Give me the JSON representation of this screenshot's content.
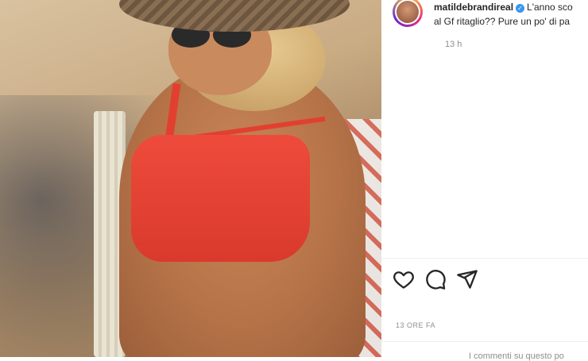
{
  "post": {
    "username": "matildebrandireal",
    "verified_badge": "✓",
    "caption_line1": "L'anno sco",
    "caption_line2": "al Gf ritaglio?? Pure un po' di pa",
    "relative_time": "13 h",
    "timestamp": "13 ORE FA",
    "comments_notice": "I commenti su questo po"
  },
  "icons": {
    "like": "heart-icon",
    "comment": "comment-icon",
    "share": "send-icon"
  }
}
